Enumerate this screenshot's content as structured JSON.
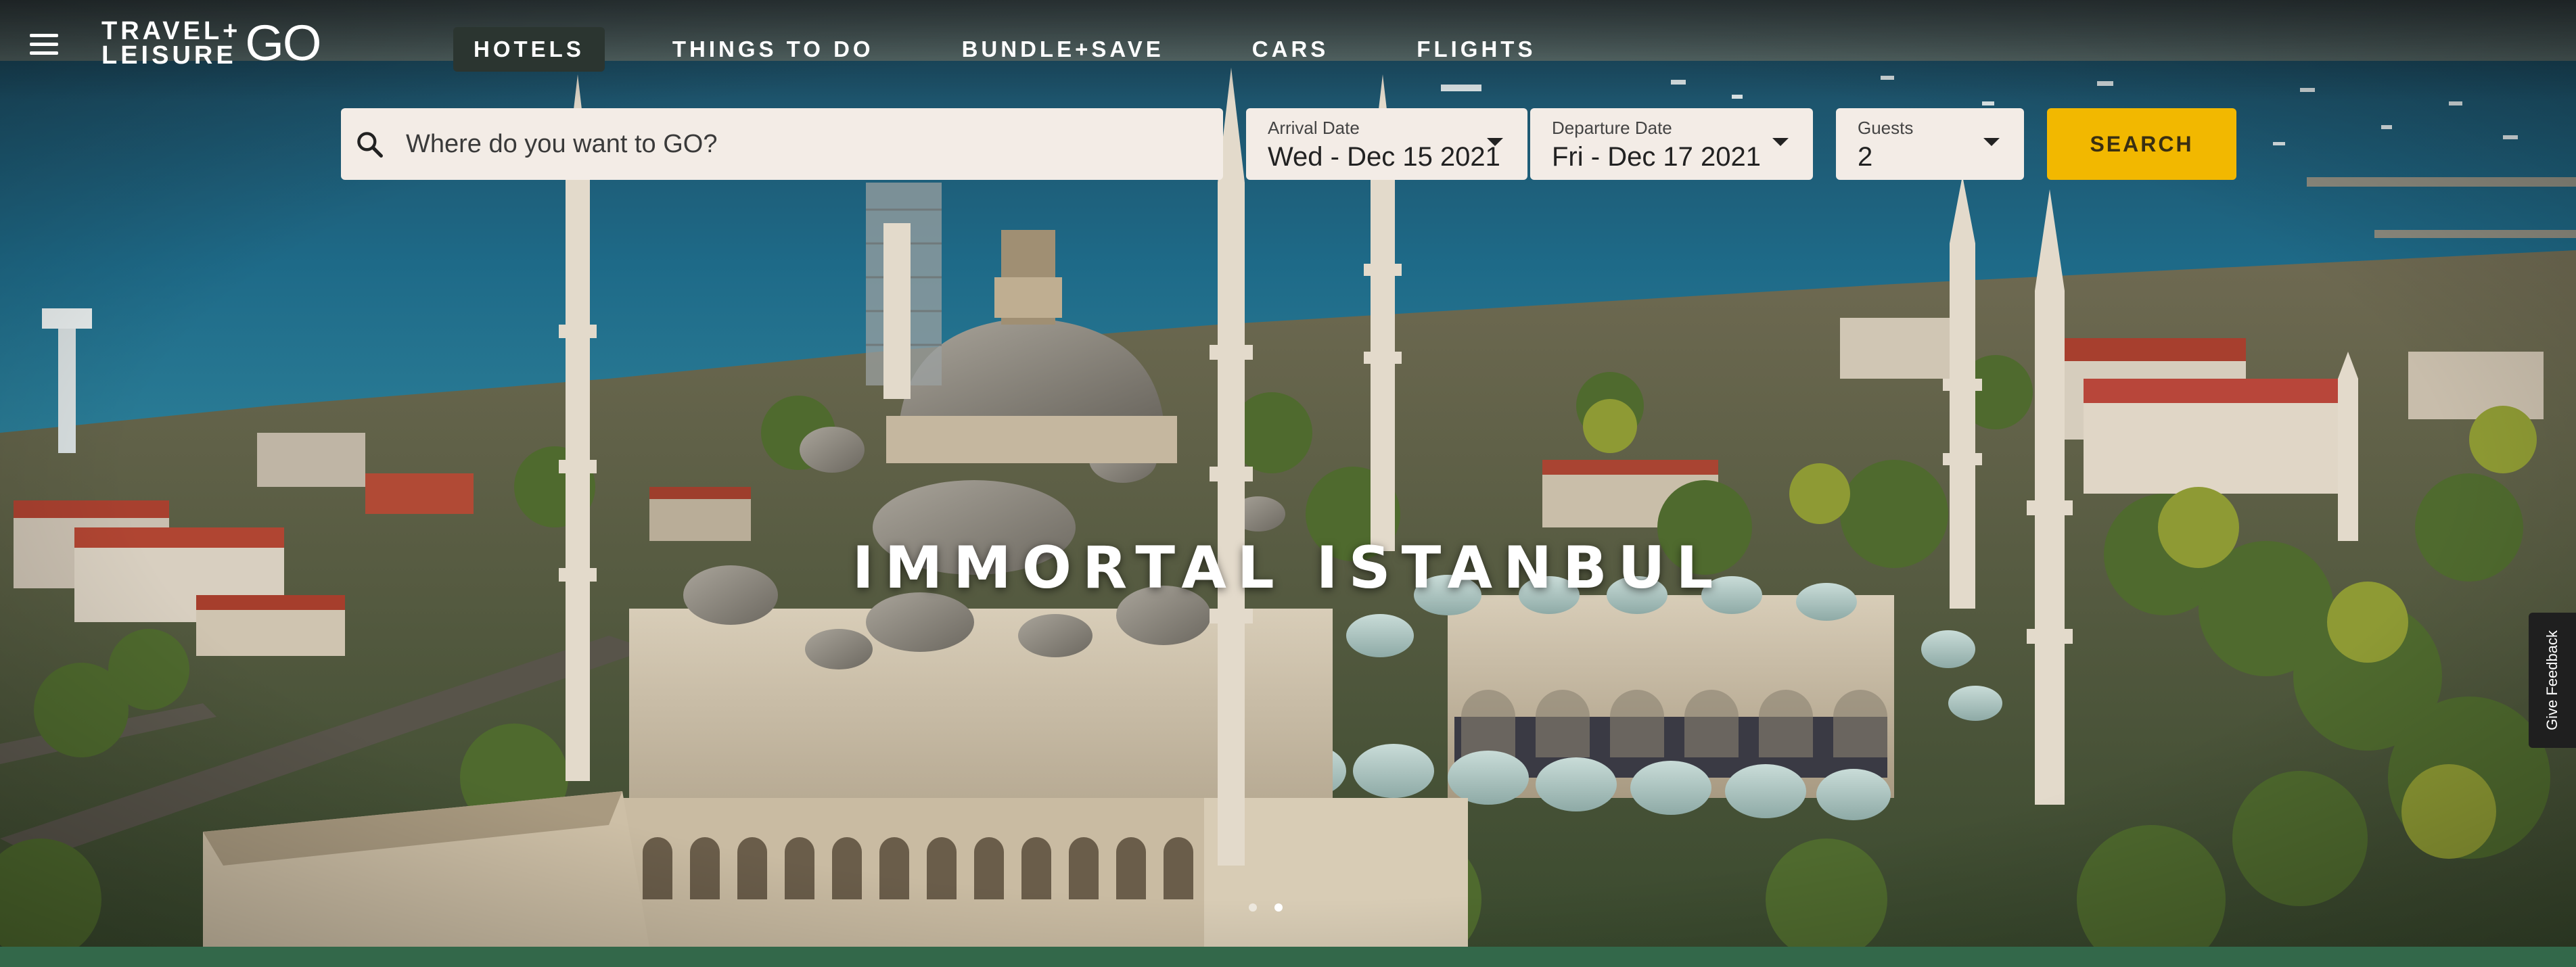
{
  "header": {
    "logo": {
      "line1": "TRAVEL+",
      "line2": "LEISURE",
      "mark": "GO"
    },
    "menu_icon": "hamburger-menu-icon",
    "tabs": [
      {
        "label": "HOTELS",
        "active": true
      },
      {
        "label": "THINGS TO DO",
        "active": false
      },
      {
        "label": "BUNDLE+SAVE",
        "active": false
      },
      {
        "label": "CARS",
        "active": false
      },
      {
        "label": "FLIGHTS",
        "active": false
      }
    ]
  },
  "search": {
    "destination": {
      "icon": "search-icon",
      "placeholder": "Where do you want to GO?"
    },
    "arrival": {
      "label": "Arrival Date",
      "value": "Wed  - Dec 15 2021"
    },
    "departure": {
      "label": "Departure Date",
      "value": "Fri  - Dec 17 2021"
    },
    "guests": {
      "label": "Guests",
      "value": "2"
    },
    "button_label": "SEARCH"
  },
  "hero": {
    "headline": "IMMORTAL ISTANBUL",
    "slides": {
      "count": 2,
      "active_index": 1
    }
  },
  "feedback": {
    "label": "Give Feedback"
  },
  "colors": {
    "accent": "#f2b800",
    "active_tab": "#2b3530",
    "search_field": "#f3ece6",
    "band": "#33684a"
  }
}
